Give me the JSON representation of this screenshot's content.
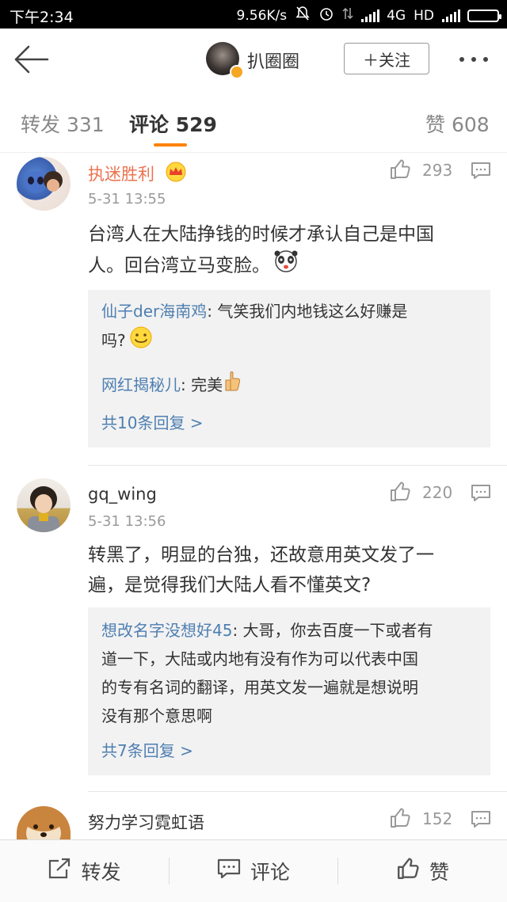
{
  "status_bar": {
    "time": "下午2:34",
    "speed": "9.56K/s",
    "network": "4G",
    "hd": "HD"
  },
  "header": {
    "username": "扒圈圈",
    "follow_label": "＋关注"
  },
  "tabs": {
    "repost": "转发 331",
    "comment": "评论 529",
    "like": "赞 608"
  },
  "comments": [
    {
      "name": "执迷胜利",
      "time": "5-31 13:55",
      "likes": "293",
      "text_line1": "台湾人在大陆挣钱的时候才承认自己是中国",
      "text_line2": "人。回台湾立马变脸。",
      "replies": [
        {
          "user": "仙子der海南鸡",
          "line1": ": 气笑我们内地钱这么好赚是",
          "line2": "吗?"
        },
        {
          "user": "网红揭秘儿",
          "line1": ": 完美"
        }
      ],
      "more": "共10条回复 >"
    },
    {
      "name": "gq_wing",
      "time": "5-31 13:56",
      "likes": "220",
      "text_line1": "转黑了，明显的台独，还故意用英文发了一",
      "text_line2": "遍，是觉得我们大陆人看不懂英文?",
      "replies": [
        {
          "user": "想改名字没想好45",
          "line1": ": 大哥，你去百度一下或者有",
          "line2": "道一下，大陆或内地有没有作为可以代表中国",
          "line3": "的专有名词的翻译，用英文发一遍就是想说明",
          "line4": "没有那个意思啊"
        }
      ],
      "more": "共7条回复 >"
    },
    {
      "name": "努力学习霓虹语",
      "likes": "152"
    }
  ],
  "bottom_bar": {
    "repost": "转发",
    "comment": "评论",
    "like": "赞"
  },
  "colors": {
    "accent": "#ff8200",
    "vip_name": "#eb7350",
    "reply_user": "#4e7fb1"
  }
}
